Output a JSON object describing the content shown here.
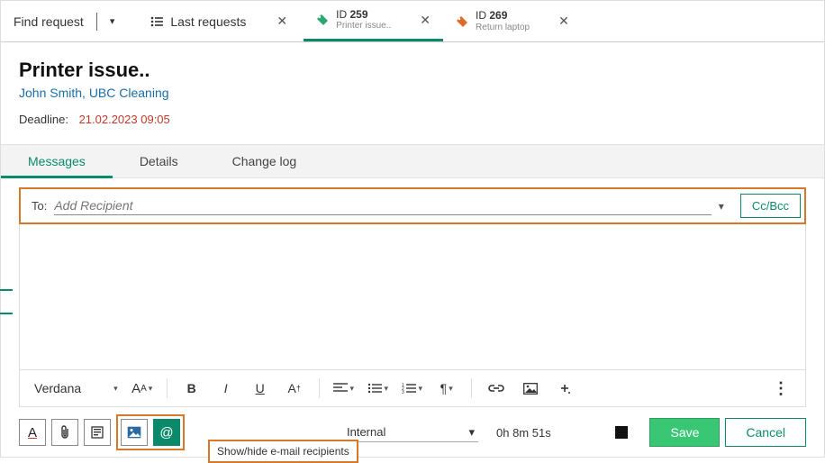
{
  "topbar": {
    "find_request": "Find request",
    "last_requests": "Last requests",
    "tabs": [
      {
        "id_prefix": "ID",
        "id_num": "259",
        "subtitle": "Printer issue..",
        "color": "green",
        "active": true
      },
      {
        "id_prefix": "ID",
        "id_num": "269",
        "subtitle": "Return laptop",
        "color": "orange",
        "active": false
      }
    ]
  },
  "header": {
    "title": "Printer issue..",
    "customer": "John Smith, UBC Cleaning",
    "deadline_label": "Deadline:",
    "deadline_value": "21.02.2023 09:05"
  },
  "tabs": {
    "messages": "Messages",
    "details": "Details",
    "changelog": "Change log"
  },
  "compose": {
    "to_label": "To:",
    "recipient_placeholder": "Add Recipient",
    "ccbcc_label": "Cc/Bcc"
  },
  "fmt": {
    "font": "Verdana",
    "fontsize_label": "A",
    "bold": "B",
    "italic": "I",
    "underline": "U",
    "clear": "A"
  },
  "bottom": {
    "tooltip": "Show/hide e-mail recipients",
    "visibility": "Internal",
    "timer": "0h 8m 51s",
    "save": "Save",
    "cancel": "Cancel"
  }
}
